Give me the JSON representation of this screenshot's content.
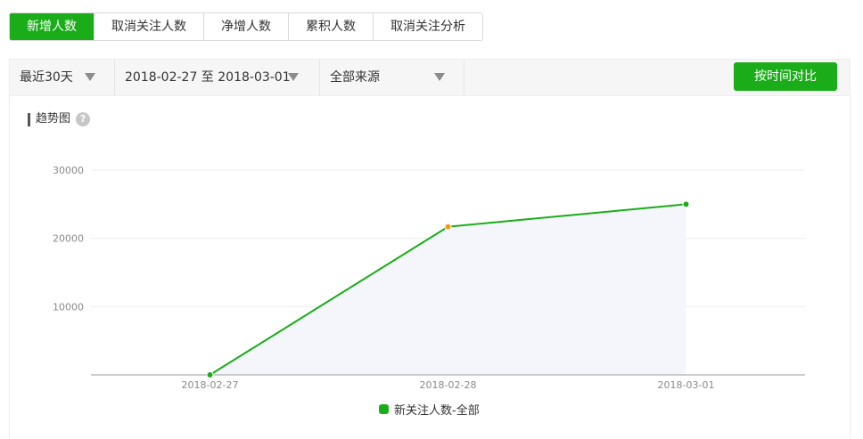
{
  "tabs": [
    {
      "label": "新增人数",
      "active": true
    },
    {
      "label": "取消关注人数",
      "active": false
    },
    {
      "label": "净增人数",
      "active": false
    },
    {
      "label": "累积人数",
      "active": false
    },
    {
      "label": "取消关注分析",
      "active": false
    }
  ],
  "filters": {
    "period": "最近30天",
    "date_range": "2018-02-27 至 2018-03-01",
    "source": "全部来源",
    "compare_button": "按时间对比"
  },
  "panel": {
    "title": "趋势图",
    "help_glyph": "?"
  },
  "colors": {
    "accent": "#1aad19",
    "line": "#1aad19",
    "highlight_point": "#f39c12",
    "area_fill": "#f5f6fb",
    "grid": "#ececec",
    "axis": "#999999"
  },
  "chart_data": {
    "type": "line",
    "categories": [
      "2018-02-27",
      "2018-02-28",
      "2018-03-01"
    ],
    "series": [
      {
        "name": "新关注人数-全部",
        "values": [
          0,
          21700,
          25000
        ],
        "highlight_index": 1
      }
    ],
    "yticks": [
      10000,
      20000,
      30000
    ],
    "ylim": [
      0,
      30000
    ],
    "grid": true,
    "legend_position": "bottom"
  }
}
